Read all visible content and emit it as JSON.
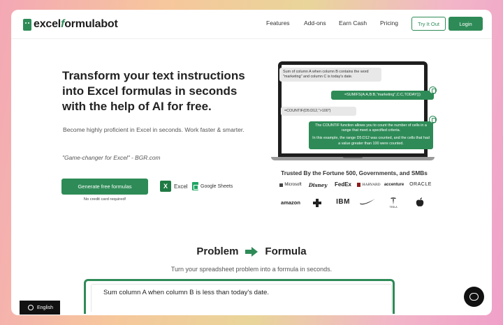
{
  "nav": {
    "logo_pre": "excel",
    "logo_f": "f",
    "logo_post": "ormulabot",
    "links": [
      "Features",
      "Add-ons",
      "Earn Cash",
      "Pricing"
    ],
    "try_label": "Try It Out",
    "login_label": "Login"
  },
  "hero": {
    "title": "Transform your text instructions into Excel formulas in seconds with the help of AI for free.",
    "subtitle": "Become highly proficient in Excel in seconds. Work faster & smarter.",
    "quote": "\"Game-changer for Excel\" - BGR.com",
    "cta_label": "Generate free formulas",
    "no_credit": "No credit card required!",
    "excel_label": "Excel",
    "sheets_label": "Google Sheets"
  },
  "laptop": {
    "msg1": "Sum of column A when column B contains the word \"marketing\" and column C is today's date.",
    "formula1": "=SUMIFS(A:A,B:B,\"marketing\",C:C,TODAY())",
    "msg2": "=COUNTIF(D5:D12,\">100\")",
    "explain1": "The COUNTIF function allows you to count the number of cells in a range that meet a specified criteria.",
    "explain2": "In this example, the range D5:D12 was counted, and the cells that had a value greater than 100 were counted."
  },
  "trusted": {
    "title": "Trusted By the Fortune 500, Governments, and SMBs",
    "brands_row1": [
      "Microsoft",
      "Disney",
      "FedEx",
      "HARVARD",
      "accenture",
      "ORACLE"
    ],
    "brands_row2": [
      "amazon",
      "",
      "IBM",
      "",
      "TESLA",
      ""
    ]
  },
  "problem": {
    "left": "Problem",
    "right": "Formula",
    "subtitle": "Turn your spreadsheet problem into a formula in seconds.",
    "demo_text": "Sum column A when column B is less than today's date."
  },
  "footer": {
    "language": "English"
  },
  "colors": {
    "accent": "#2e8b57"
  }
}
